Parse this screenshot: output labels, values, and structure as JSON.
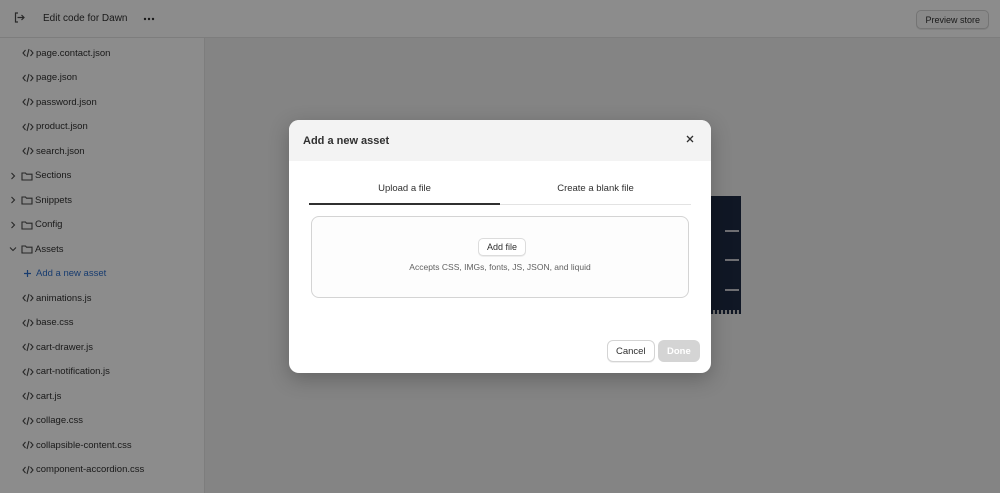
{
  "topbar": {
    "title": "Edit code for Dawn",
    "exit_icon": "exit-icon",
    "more_icon": "more-horizontal-icon",
    "preview_label": "Preview store"
  },
  "sidebar": {
    "items": [
      {
        "label": "page.contact.json",
        "type": "file"
      },
      {
        "label": "page.json",
        "type": "file"
      },
      {
        "label": "password.json",
        "type": "file"
      },
      {
        "label": "product.json",
        "type": "file"
      },
      {
        "label": "search.json",
        "type": "file"
      },
      {
        "label": "Sections",
        "type": "folder",
        "expanded": false
      },
      {
        "label": "Snippets",
        "type": "folder",
        "expanded": false
      },
      {
        "label": "Config",
        "type": "folder",
        "expanded": false
      },
      {
        "label": "Assets",
        "type": "folder",
        "expanded": true
      },
      {
        "label": "Add a new asset",
        "type": "add"
      },
      {
        "label": "animations.js",
        "type": "file"
      },
      {
        "label": "base.css",
        "type": "file"
      },
      {
        "label": "cart-drawer.js",
        "type": "file"
      },
      {
        "label": "cart-notification.js",
        "type": "file"
      },
      {
        "label": "cart.js",
        "type": "file"
      },
      {
        "label": "collage.css",
        "type": "file"
      },
      {
        "label": "collapsible-content.css",
        "type": "file"
      },
      {
        "label": "component-accordion.css",
        "type": "file"
      }
    ]
  },
  "modal": {
    "title": "Add a new asset",
    "close_icon": "close-icon",
    "tabs": [
      {
        "label": "Upload a file",
        "active": true
      },
      {
        "label": "Create a blank file",
        "active": false
      }
    ],
    "add_file_label": "Add file",
    "hint": "Accepts CSS, IMGs, fonts, JS, JSON, and liquid",
    "cancel_label": "Cancel",
    "done_label": "Done",
    "done_enabled": false
  },
  "colors": {
    "accent_link": "#2c6ecb",
    "text": "#303030",
    "overlay": "rgba(0,0,0,0.45)",
    "preview_dark": "#1e2a44"
  }
}
